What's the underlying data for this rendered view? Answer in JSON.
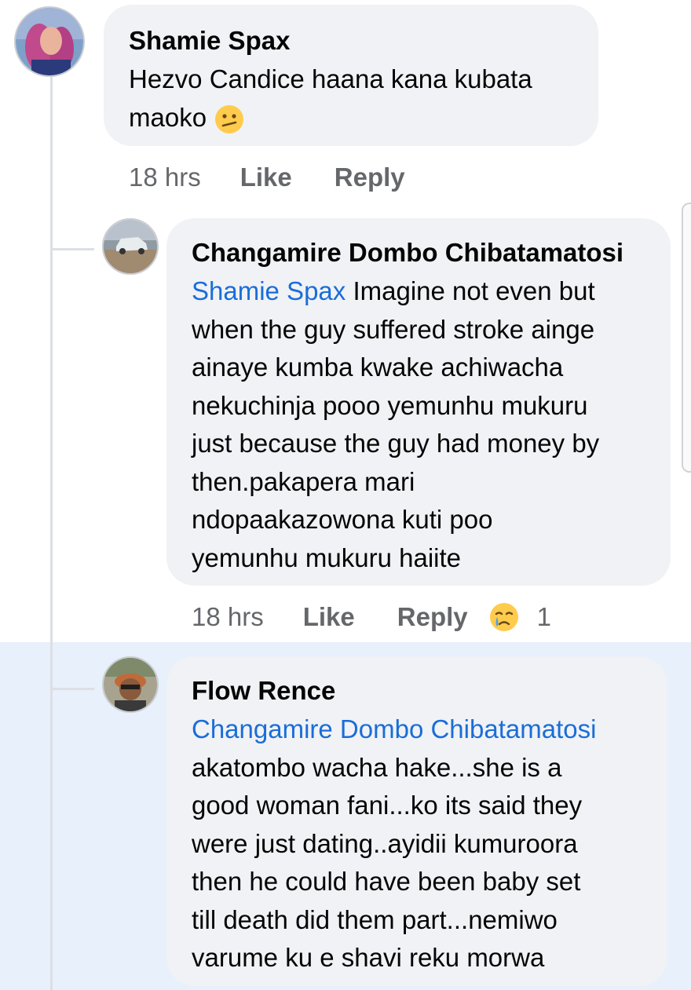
{
  "comments": [
    {
      "author": "Shamie Spax",
      "lines": [
        "Hezvo Candice haana kana kubata",
        "maoko"
      ],
      "emoji": "confused-face",
      "time": "18 hrs",
      "like_label": "Like",
      "reply_label": "Reply"
    },
    {
      "author": "Changamire Dombo Chibatamatosi",
      "mention": "Shamie Spax",
      "first_line_rest": " Imagine not even but",
      "lines": [
        "when the guy suffered stroke ainge",
        "ainaye kumba kwake achiwacha",
        "nekuchinja pooo yemunhu mukuru",
        "just because the guy had money by",
        "then.pakapera mari",
        "ndopaakazowona kuti poo",
        "yemunhu mukuru haiite"
      ],
      "time": "18 hrs",
      "like_label": "Like",
      "reply_label": "Reply",
      "reaction": "crying-face",
      "reaction_count": "1"
    },
    {
      "author": "Flow Rence",
      "mention": "Changamire Dombo Chibatamatosi",
      "lines": [
        "akatombo wacha hake...she is a",
        "good woman fani...ko its said they",
        "were just dating..ayidii kumuroora",
        "then he could have been baby set",
        "till death did them part...nemiwo",
        "varume ku e shavi reku morwa"
      ]
    }
  ],
  "colors": {
    "mention": "#1a6dd8",
    "bubble": "#f0f2f5",
    "meta": "#65676b",
    "highlight": "#e7f0fb"
  }
}
